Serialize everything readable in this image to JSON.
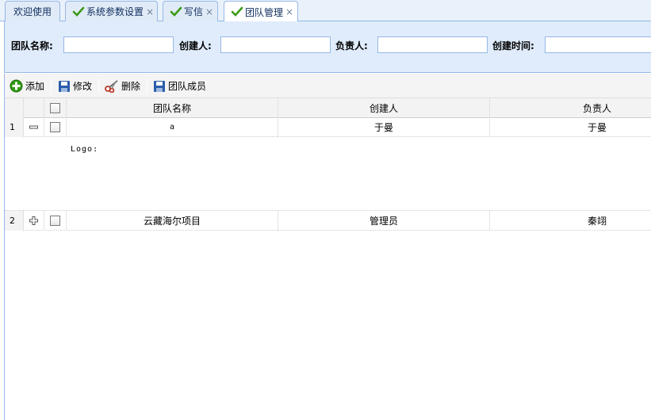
{
  "tabs": [
    {
      "label": "欢迎使用",
      "closable": false,
      "checked": false,
      "active": false
    },
    {
      "label": "系统参数设置",
      "closable": true,
      "checked": true,
      "active": false
    },
    {
      "label": "写信",
      "closable": true,
      "checked": true,
      "active": false
    },
    {
      "label": "团队管理",
      "closable": true,
      "checked": true,
      "active": true
    }
  ],
  "tab_close_glyph": "×",
  "search": {
    "team_name_label": "团队名称:",
    "team_name_value": "",
    "creator_label": "创建人:",
    "creator_value": "",
    "owner_label": "负责人:",
    "owner_value": "",
    "created_time_label": "创建时间:",
    "created_time_value": ""
  },
  "toolbar": {
    "add_label": "添加",
    "edit_label": "修改",
    "delete_label": "删除",
    "members_label": "团队成员"
  },
  "grid": {
    "columns": [
      "团队名称",
      "创建人",
      "负责人"
    ],
    "rows": [
      {
        "num": "1",
        "team_name": "a",
        "creator": "于曼",
        "owner": "于曼",
        "expanded": true,
        "detail": "Logo:"
      },
      {
        "num": "2",
        "team_name": "云藏海尔项目",
        "creator": "管理员",
        "owner": "秦翊",
        "expanded": false
      }
    ]
  },
  "colors": {
    "border": "#95b8e7",
    "tab_text": "#0e2d5f",
    "panel_bg": "#e0ecfb",
    "check_green": "#3b9a17",
    "add_green": "#2e9b12",
    "save_blue": "#2a5caa"
  },
  "icons": {
    "tab_check": "check-icon",
    "add": "add-icon",
    "edit": "save-icon",
    "delete": "scissors-icon",
    "members": "save-icon"
  }
}
